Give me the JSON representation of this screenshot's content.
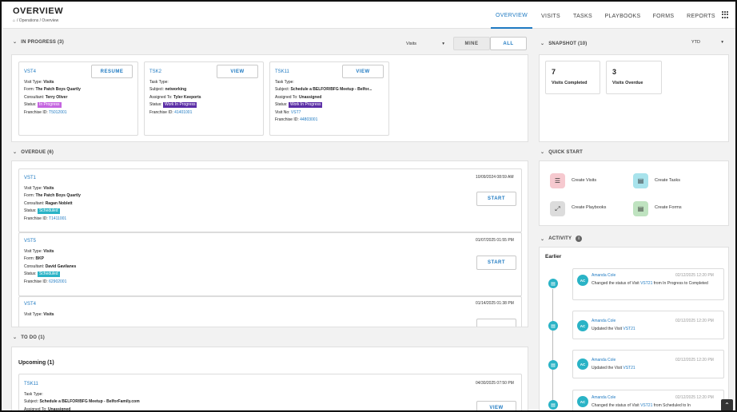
{
  "header": {
    "title": "OVERVIEW",
    "breadcrumb": "/ Operations / Overview",
    "nav": [
      "OVERVIEW",
      "VISITS",
      "TASKS",
      "PLAYBOOKS",
      "FORMS",
      "REPORTS"
    ]
  },
  "in_progress": {
    "heading": "IN PROGRESS (3)",
    "filter": "Visits",
    "toggle_mine": "MINE",
    "toggle_all": "ALL",
    "cards": [
      {
        "id": "VST4",
        "btn": "RESUME",
        "l1k": "Visit Type: ",
        "l1v": "Visits",
        "l2k": "Form: ",
        "l2v": "The Patch Boys Quartly",
        "l3k": "Consultant: ",
        "l3v": "Terry Oliver",
        "l4k": "Status: ",
        "l4v": "In Progress",
        "l5k": "Franchise ID: ",
        "l5v": "T5012001"
      },
      {
        "id": "TSK2",
        "btn": "VIEW",
        "l1k": "Task Type:",
        "l1v": "",
        "l2k": "Subject: ",
        "l2v": "networking",
        "l3k": "Assigned To: ",
        "l3v": "Tyler Keeports",
        "l4k": "Status: ",
        "l4v": "Work In Progress",
        "l5k": "Franchise ID: ",
        "l5v": "41401001"
      },
      {
        "id": "TSK11",
        "btn": "VIEW",
        "l1k": "Task Type:",
        "l1v": "",
        "l2k": "Subject: ",
        "l2v": "Schedule a BELFOR/BFG Meetup - Belfor...",
        "l3k": "Assigned To: ",
        "l3v": "Unassigned",
        "l4k": "Status: ",
        "l4v": "Work In Progress",
        "l5k": "Visit No: ",
        "l5v": "VST7",
        "l6k": "Franchise ID: ",
        "l6v": "44803001"
      }
    ]
  },
  "overdue": {
    "heading": "OVERDUE (6)",
    "items": [
      {
        "id": "VST1",
        "time": "10/09/2024 08:59 AM",
        "btn": "START",
        "l1v": "Visits",
        "l2v": "The Patch Boys Quartly",
        "l3v": "Ragan Noblett",
        "l4v": "Scheduled",
        "l5v": "T1411001"
      },
      {
        "id": "VST5",
        "time": "01/07/2025 01:55 PM",
        "btn": "START",
        "l1v": "Visits",
        "l2v": "BKP",
        "l3v": "David Gavilanes",
        "l4v": "Scheduled",
        "l5v": "62902001"
      },
      {
        "id": "VST4",
        "time": "01/14/2025 01:38 PM",
        "btn": "",
        "l1v": "Visits",
        "l2v": "",
        "l3v": "",
        "l4v": "",
        "l5v": ""
      }
    ],
    "k1": "Visit Type: ",
    "k2": "Form: ",
    "k3": "Consultant: ",
    "k4": "Status: ",
    "k5": "Franchise ID: "
  },
  "todo": {
    "heading": "TO DO (1)",
    "sub": "Upcoming (1)",
    "item": {
      "id": "TSK11",
      "time": "04/30/2025 07:50 PM",
      "btn": "VIEW",
      "l1k": "Task Type:",
      "l2k": "Subject: ",
      "l2v": "Schedule a BELFOR/BFG Meetup - BelforFamily.com",
      "l3k": "Assigned To: ",
      "l3v": "Unassigned"
    }
  },
  "snapshot": {
    "heading": "SNAPSHOT (10)",
    "period": "YTD",
    "tiles": [
      {
        "value": "7",
        "label": "Visits Completed"
      },
      {
        "value": "3",
        "label": "Visits Overdue"
      }
    ]
  },
  "quick_start": {
    "heading": "QUICK START",
    "items": [
      {
        "label": "Create Visits",
        "icon": "layers-icon",
        "color": "#f6c9cf"
      },
      {
        "label": "Create Tasks",
        "icon": "clipboard-icon",
        "color": "#a8e3ec"
      },
      {
        "label": "Create Playbooks",
        "icon": "expand-icon",
        "color": "#dcdcdc"
      },
      {
        "label": "Create Forms",
        "icon": "form-icon",
        "color": "#bfe3c0"
      }
    ]
  },
  "activity": {
    "heading": "ACTIVITY",
    "group": "Earlier",
    "items": [
      {
        "initials": "AC",
        "name": "Amanda Cole",
        "time": "02/12/2025 12:20 PM",
        "pre": "Changed the status of Visit ",
        "link": "VST21",
        "post": " from In Progress to Completed"
      },
      {
        "initials": "AC",
        "name": "Amanda Cole",
        "time": "02/12/2025 12:20 PM",
        "pre": "Updated the Visit ",
        "link": "VST21",
        "post": ""
      },
      {
        "initials": "AC",
        "name": "Amanda Cole",
        "time": "02/12/2025 12:20 PM",
        "pre": "Updated the Visit ",
        "link": "VST21",
        "post": ""
      },
      {
        "initials": "AC",
        "name": "Amanda Cole",
        "time": "02/12/2025 12:20 PM",
        "pre": "Changed the status of Visit ",
        "link": "VST21",
        "post": " from Scheduled to In"
      }
    ]
  },
  "colors": {
    "accent": "#1f7ac2",
    "in_progress": "#c565e0",
    "work_in_progress": "#5b2ea6",
    "scheduled": "#2ab3c6"
  }
}
